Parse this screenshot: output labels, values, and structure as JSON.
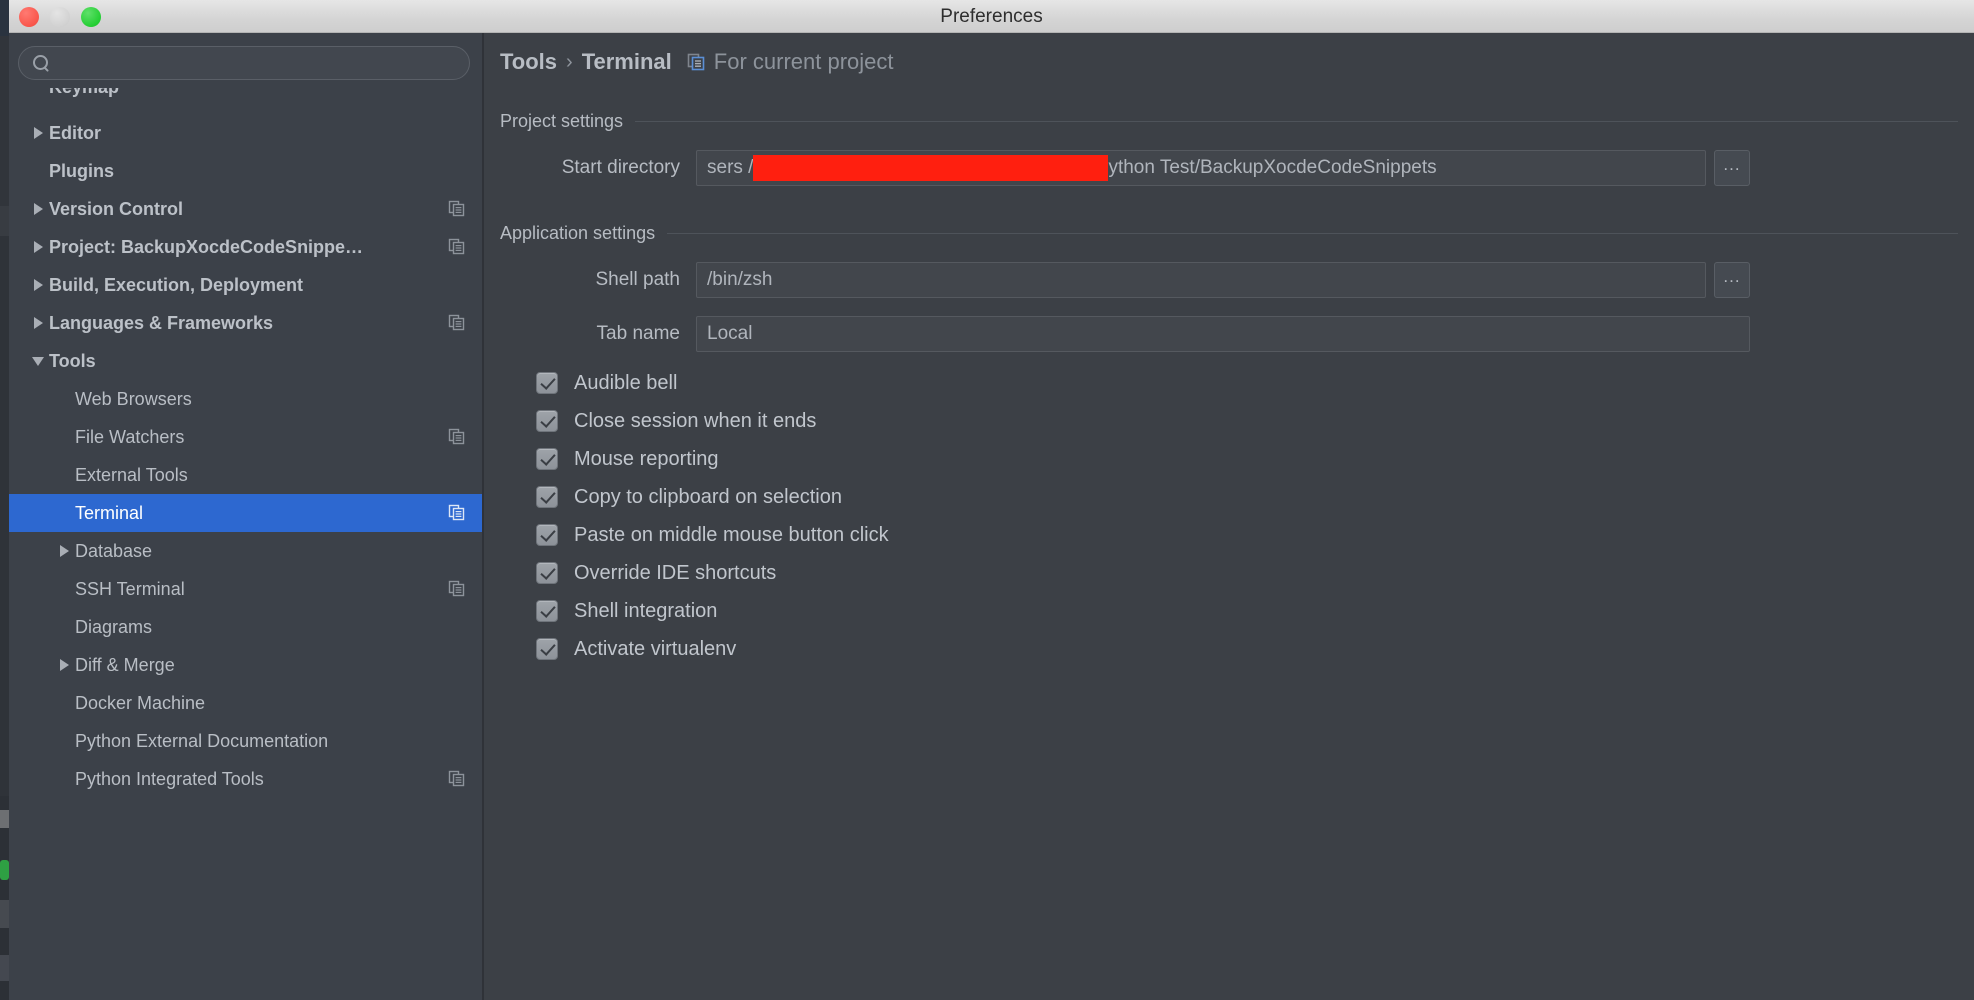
{
  "window": {
    "title": "Preferences",
    "traffic_lights": [
      "close-red",
      "minimize-gray",
      "zoom-green"
    ]
  },
  "sidebar": {
    "search": {
      "value": "",
      "placeholder": ""
    },
    "items": [
      {
        "label": "Keymap",
        "level": 1,
        "twisty": "none",
        "badge": false,
        "selected": false,
        "clipped": true,
        "bold": true
      },
      {
        "label": "Editor",
        "level": 1,
        "twisty": "right",
        "badge": false,
        "selected": false,
        "clipped": false,
        "bold": true
      },
      {
        "label": "Plugins",
        "level": 1,
        "twisty": "none",
        "badge": false,
        "selected": false,
        "clipped": false,
        "bold": true
      },
      {
        "label": "Version Control",
        "level": 1,
        "twisty": "right",
        "badge": true,
        "selected": false,
        "clipped": false,
        "bold": true
      },
      {
        "label": "Project: BackupXocdeCodeSnippe…",
        "level": 1,
        "twisty": "right",
        "badge": true,
        "selected": false,
        "clipped": false,
        "bold": true
      },
      {
        "label": "Build, Execution, Deployment",
        "level": 1,
        "twisty": "right",
        "badge": false,
        "selected": false,
        "clipped": false,
        "bold": true
      },
      {
        "label": "Languages & Frameworks",
        "level": 1,
        "twisty": "right",
        "badge": true,
        "selected": false,
        "clipped": false,
        "bold": true
      },
      {
        "label": "Tools",
        "level": 1,
        "twisty": "down",
        "badge": false,
        "selected": false,
        "clipped": false,
        "bold": true
      },
      {
        "label": "Web Browsers",
        "level": 2,
        "twisty": "none",
        "badge": false,
        "selected": false,
        "clipped": false,
        "bold": false
      },
      {
        "label": "File Watchers",
        "level": 2,
        "twisty": "none",
        "badge": true,
        "selected": false,
        "clipped": false,
        "bold": false
      },
      {
        "label": "External Tools",
        "level": 2,
        "twisty": "none",
        "badge": false,
        "selected": false,
        "clipped": false,
        "bold": false
      },
      {
        "label": "Terminal",
        "level": 2,
        "twisty": "none",
        "badge": true,
        "selected": true,
        "clipped": false,
        "bold": false
      },
      {
        "label": "Database",
        "level": 2,
        "twisty": "right",
        "badge": false,
        "selected": false,
        "clipped": false,
        "bold": false
      },
      {
        "label": "SSH Terminal",
        "level": 2,
        "twisty": "none",
        "badge": true,
        "selected": false,
        "clipped": false,
        "bold": false
      },
      {
        "label": "Diagrams",
        "level": 2,
        "twisty": "none",
        "badge": false,
        "selected": false,
        "clipped": false,
        "bold": false
      },
      {
        "label": "Diff & Merge",
        "level": 2,
        "twisty": "right",
        "badge": false,
        "selected": false,
        "clipped": false,
        "bold": false
      },
      {
        "label": "Docker Machine",
        "level": 2,
        "twisty": "none",
        "badge": false,
        "selected": false,
        "clipped": false,
        "bold": false
      },
      {
        "label": "Python External Documentation",
        "level": 2,
        "twisty": "none",
        "badge": false,
        "selected": false,
        "clipped": false,
        "bold": false
      },
      {
        "label": "Python Integrated Tools",
        "level": 2,
        "twisty": "none",
        "badge": true,
        "selected": false,
        "clipped": false,
        "bold": false
      }
    ]
  },
  "panel": {
    "breadcrumb": {
      "root": "Tools",
      "separator": "›",
      "leaf": "Terminal",
      "scope_icon": "copy-to-project-icon",
      "scope_label": "For current project"
    },
    "project_settings": {
      "title": "Project settings",
      "start_directory": {
        "label": "Start directory",
        "prefix": "sers /",
        "suffix": "ython Test/BackupXocdeCodeSnippets",
        "redacted": true,
        "browse_label": "..."
      }
    },
    "application_settings": {
      "title": "Application settings",
      "shell_path": {
        "label": "Shell path",
        "value": "/bin/zsh",
        "browse_label": "..."
      },
      "tab_name": {
        "label": "Tab name",
        "value": "Local"
      },
      "checkboxes": [
        {
          "label": "Audible bell",
          "checked": true
        },
        {
          "label": "Close session when it ends",
          "checked": true
        },
        {
          "label": "Mouse reporting",
          "checked": true
        },
        {
          "label": "Copy to clipboard on selection",
          "checked": true
        },
        {
          "label": "Paste on middle mouse button click",
          "checked": true
        },
        {
          "label": "Override IDE shortcuts",
          "checked": true
        },
        {
          "label": "Shell integration",
          "checked": true
        },
        {
          "label": "Activate virtualenv",
          "checked": true
        }
      ]
    }
  },
  "colors": {
    "selection_blue": "#2d68d0",
    "sidebar_bg": "#3c4149",
    "panel_bg": "#3c4046",
    "titlebar_bg": "#d8d8d8",
    "redaction_red": "#ff1f0f",
    "text_primary": "#c1c6cd",
    "text_muted": "#8d939b"
  }
}
